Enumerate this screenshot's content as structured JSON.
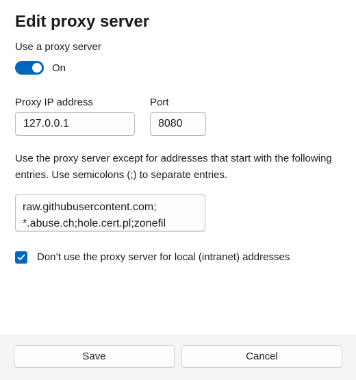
{
  "title": "Edit proxy server",
  "subhead": "Use a proxy server",
  "toggle": {
    "state": "On"
  },
  "ip": {
    "label": "Proxy IP address",
    "value": "127.0.0.1"
  },
  "port": {
    "label": "Port",
    "value": "8080"
  },
  "exceptions_help": "Use the proxy server except for addresses that start with the following entries. Use semicolons (;) to separate entries.",
  "exceptions_value": "raw.githubusercontent.com;\n*.abuse.ch;hole.cert.pl;zonefil",
  "local_bypass": {
    "label": "Don’t use the proxy server for local (intranet) addresses",
    "checked": true
  },
  "buttons": {
    "save": "Save",
    "cancel": "Cancel"
  }
}
